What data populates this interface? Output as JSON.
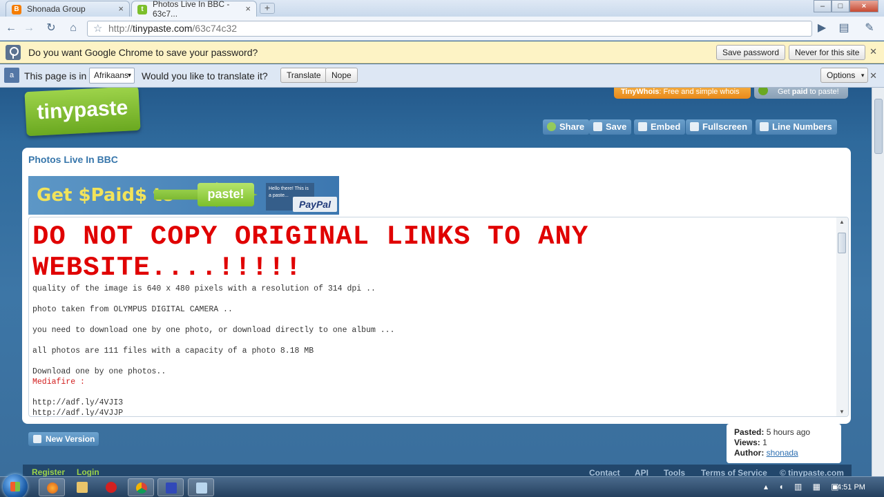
{
  "browser": {
    "tabs": [
      {
        "label": "Shonada Group",
        "active": false,
        "favicon": "blogger-icon",
        "favicon_color": "#f57d00"
      },
      {
        "label": "Photos Live In BBC - 63c7...",
        "active": true,
        "favicon": "tinypaste-icon",
        "favicon_color": "#7cbf2b"
      }
    ],
    "url": {
      "scheme": "http://",
      "host": "tinypaste.com",
      "path": "/63c74c32"
    }
  },
  "password_bar": {
    "message": "Do you want Google Chrome to save your password?",
    "save_label": "Save password",
    "never_label": "Never for this site"
  },
  "translate_bar": {
    "prefix": "This page is in",
    "language": "Afrikaans",
    "question": "Would you like to translate it?",
    "translate_label": "Translate",
    "nope_label": "Nope",
    "options_label": "Options"
  },
  "site": {
    "logo_text": "tinypaste",
    "promo_whois_bold": "TinyWhois",
    "promo_whois_rest": ": Free and simple whois",
    "promo_paid_pre": "Get ",
    "promo_paid_bold": "paid",
    "promo_paid_rest": " to paste!",
    "actions": [
      {
        "label": "Share",
        "icon": "share-icon"
      },
      {
        "label": "Save",
        "icon": "save-icon"
      },
      {
        "label": "Embed",
        "icon": "embed-icon"
      },
      {
        "label": "Fullscreen",
        "icon": "fullscreen-icon"
      },
      {
        "label": "Line Numbers",
        "icon": "line-numbers-icon"
      }
    ],
    "accent": "#3776ab"
  },
  "paste": {
    "title": "Photos Live In BBC",
    "banner": {
      "get_paid": "Get $Paid$ to",
      "paste": "paste!",
      "hello": "Hello there! This is a paste...",
      "paypal": "PayPal"
    },
    "warning_line1": "DO NOT COPY ORIGINAL LINKS TO ANY",
    "warning_line2": "WEBSITE....!!!!!",
    "lines": [
      "quality of the image is 640 x 480 pixels with a resolution of 314 dpi ..",
      "photo taken from OLYMPUS DIGITAL CAMERA ..",
      "you need to download one by one photo, or download directly to one album ...",
      "all photos are 111 files with a capacity of a photo 8.18 MB",
      "Download one by one photos..",
      "Mediafire :",
      "http://adf.ly/4VJI3",
      "http://adf.ly/4VJJP"
    ],
    "warning_color": "#e00000"
  },
  "new_version_label": "New Version",
  "meta": {
    "pasted_label": "Pasted:",
    "pasted_value": "5 hours ago",
    "views_label": "Views:",
    "views_value": "1",
    "author_label": "Author:",
    "author_value": "shonada"
  },
  "footer": {
    "register": "Register",
    "login": "Login",
    "links": [
      "Contact",
      "API",
      "Tools",
      "Terms of Service"
    ],
    "copyright": "© tinypaste.com"
  },
  "taskbar": {
    "apps": [
      "firefox-icon",
      "explorer-icon",
      "opera-icon",
      "chrome-icon",
      "app-icon",
      "notepad-icon"
    ],
    "time": "4:51 PM"
  }
}
